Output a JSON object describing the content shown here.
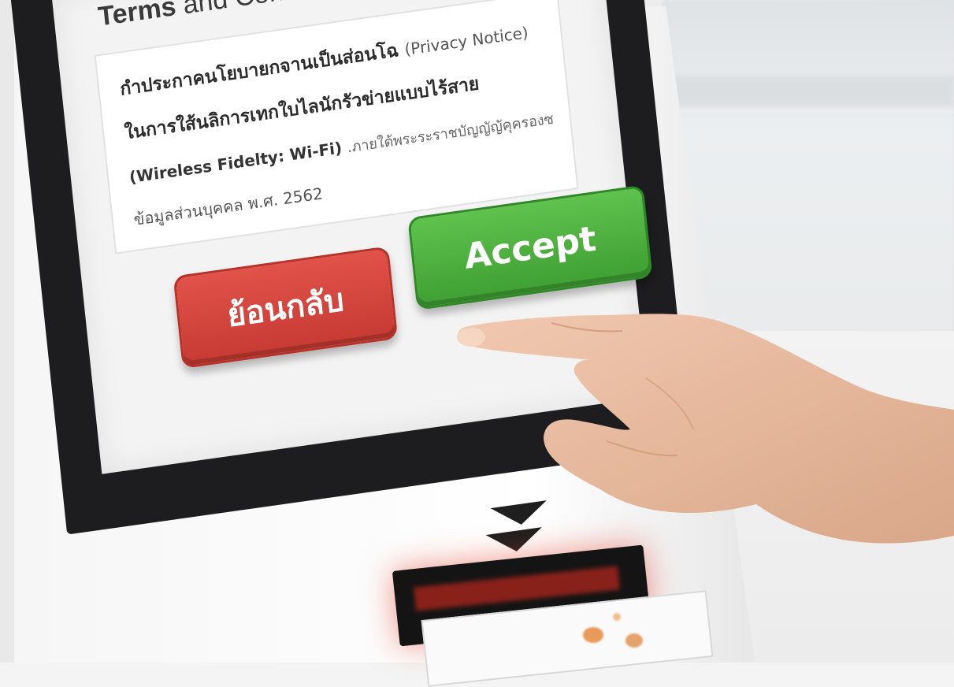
{
  "screen": {
    "title_strong": "Terms",
    "title_rest": "and Conditions",
    "notice": {
      "line1_main": "กำประกาคนโยบายกจานเป็นส่อนโฉ",
      "line1_soft": "(Privacy Notice)",
      "line2": "ในการใส้นลิการเทกใบไลนักรัวข่ายแบบไร้สาย",
      "line3_main": "(Wireless Fidelty: Wi-Fi)",
      "line3_soft": ".ภายใต้พระระราชบัญญัญัคุครองซ",
      "line4": "ข้อมูลส่วนบุคคล พ.ศ. 2562"
    },
    "buttons": {
      "back_label": "ย้อนกลับ",
      "accept_label": "Accept"
    }
  },
  "colors": {
    "back_button": "#d1443d",
    "accept_button": "#4fb13f",
    "bezel": "#1d1d1f",
    "slot_glow": "#c8281e"
  },
  "icons": {
    "arrow": "double-chevron-down-icon"
  }
}
